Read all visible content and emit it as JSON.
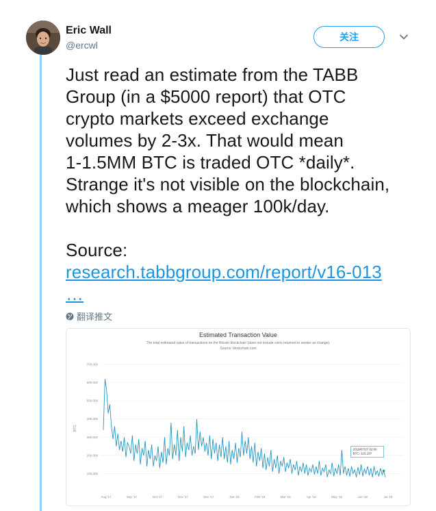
{
  "user": {
    "display_name": "Eric Wall",
    "handle": "@ercwl"
  },
  "follow_button": {
    "label": "关注"
  },
  "tweet": {
    "lines": [
      "Just read an estimate from the TABB",
      "Group (in a $5000 report) that OTC",
      "crypto markets exceed exchange",
      "volumes by 2-3x. That would mean",
      "1-1.5MM BTC is traded OTC *daily*.",
      "Strange it's not visible on the blockchain,",
      "which shows a meager 100k/day."
    ],
    "source_label": "Source:",
    "link_text": "research.tabbgroup.com/report/v16-013",
    "ellipsis": "…"
  },
  "translate": {
    "label": "翻译推文"
  },
  "colors": {
    "accent": "#1da1f2",
    "link": "#1b95e0",
    "thread_line": "#8fd0f5",
    "chart_line": "#2196c3",
    "muted": "#657786"
  },
  "icons": {
    "caret": "chevron-down-icon",
    "translate": "globe-icon"
  },
  "chart_data": {
    "type": "line",
    "title": "Estimated Transaction Value",
    "subtitle": "The total estimated value of transactions on the Bitcoin blockchain (does not include coins returned to sender as change).",
    "source": "Source: blockchain.com",
    "ylabel": "BTC",
    "ylim": [
      0,
      700000
    ],
    "y_ticks": [
      "700,000",
      "600,000",
      "500,000",
      "400,000",
      "300,000",
      "200,000",
      "100,000"
    ],
    "x_ticks": [
      "Aug '17",
      "Sep '17",
      "Oct '17",
      "Nov '17",
      "Dec '17",
      "Jan '18",
      "Feb '18",
      "Mar '18",
      "Apr '18",
      "May '18",
      "Jun '18",
      "Jul '18"
    ],
    "tooltip": {
      "date": "2018/07/27 02:00",
      "value": "BTC: 115,187"
    },
    "series": [
      {
        "values": [
          340000,
          620000,
          560000,
          430000,
          480000,
          360000,
          290000,
          360000,
          250000,
          320000,
          230000,
          280000,
          220000,
          300000,
          190000,
          270000,
          250000,
          210000,
          310000,
          170000,
          260000,
          210000,
          290000,
          150000,
          240000,
          200000,
          280000,
          140000,
          230000,
          180000,
          260000,
          140000,
          200000,
          170000,
          250000,
          130000,
          220000,
          160000,
          300000,
          150000,
          240000,
          200000,
          380000,
          180000,
          260000,
          200000,
          340000,
          170000,
          300000,
          220000,
          360000,
          190000,
          270000,
          230000,
          310000,
          200000,
          250000,
          210000,
          400000,
          230000,
          330000,
          250000,
          300000,
          220000,
          270000,
          200000,
          310000,
          180000,
          290000,
          210000,
          270000,
          170000,
          260000,
          190000,
          300000,
          180000,
          250000,
          160000,
          280000,
          150000,
          230000,
          180000,
          270000,
          160000,
          240000,
          190000,
          330000,
          200000,
          280000,
          210000,
          300000,
          180000,
          250000,
          160000,
          270000,
          140000,
          220000,
          170000,
          240000,
          130000,
          210000,
          120000,
          190000,
          140000,
          230000,
          110000,
          180000,
          130000,
          200000,
          100000,
          170000,
          140000,
          190000,
          110000,
          160000,
          130000,
          180000,
          100000,
          150000,
          120000,
          170000,
          90000,
          140000,
          110000,
          160000,
          100000,
          150000,
          90000,
          130000,
          110000,
          150000,
          95000,
          140000,
          100000,
          170000,
          90000,
          130000,
          110000,
          150000,
          80000,
          120000,
          100000,
          160000,
          85000,
          130000,
          100000,
          150000,
          90000,
          230000,
          100000,
          140000,
          90000,
          130000,
          85000,
          140000,
          100000,
          120000,
          80000,
          135000,
          95000,
          150000,
          85000,
          125000,
          100000,
          140000,
          90000,
          130000,
          80000,
          140000,
          95000,
          115000,
          85000,
          130000,
          95000,
          115187,
          80000
        ]
      }
    ]
  }
}
